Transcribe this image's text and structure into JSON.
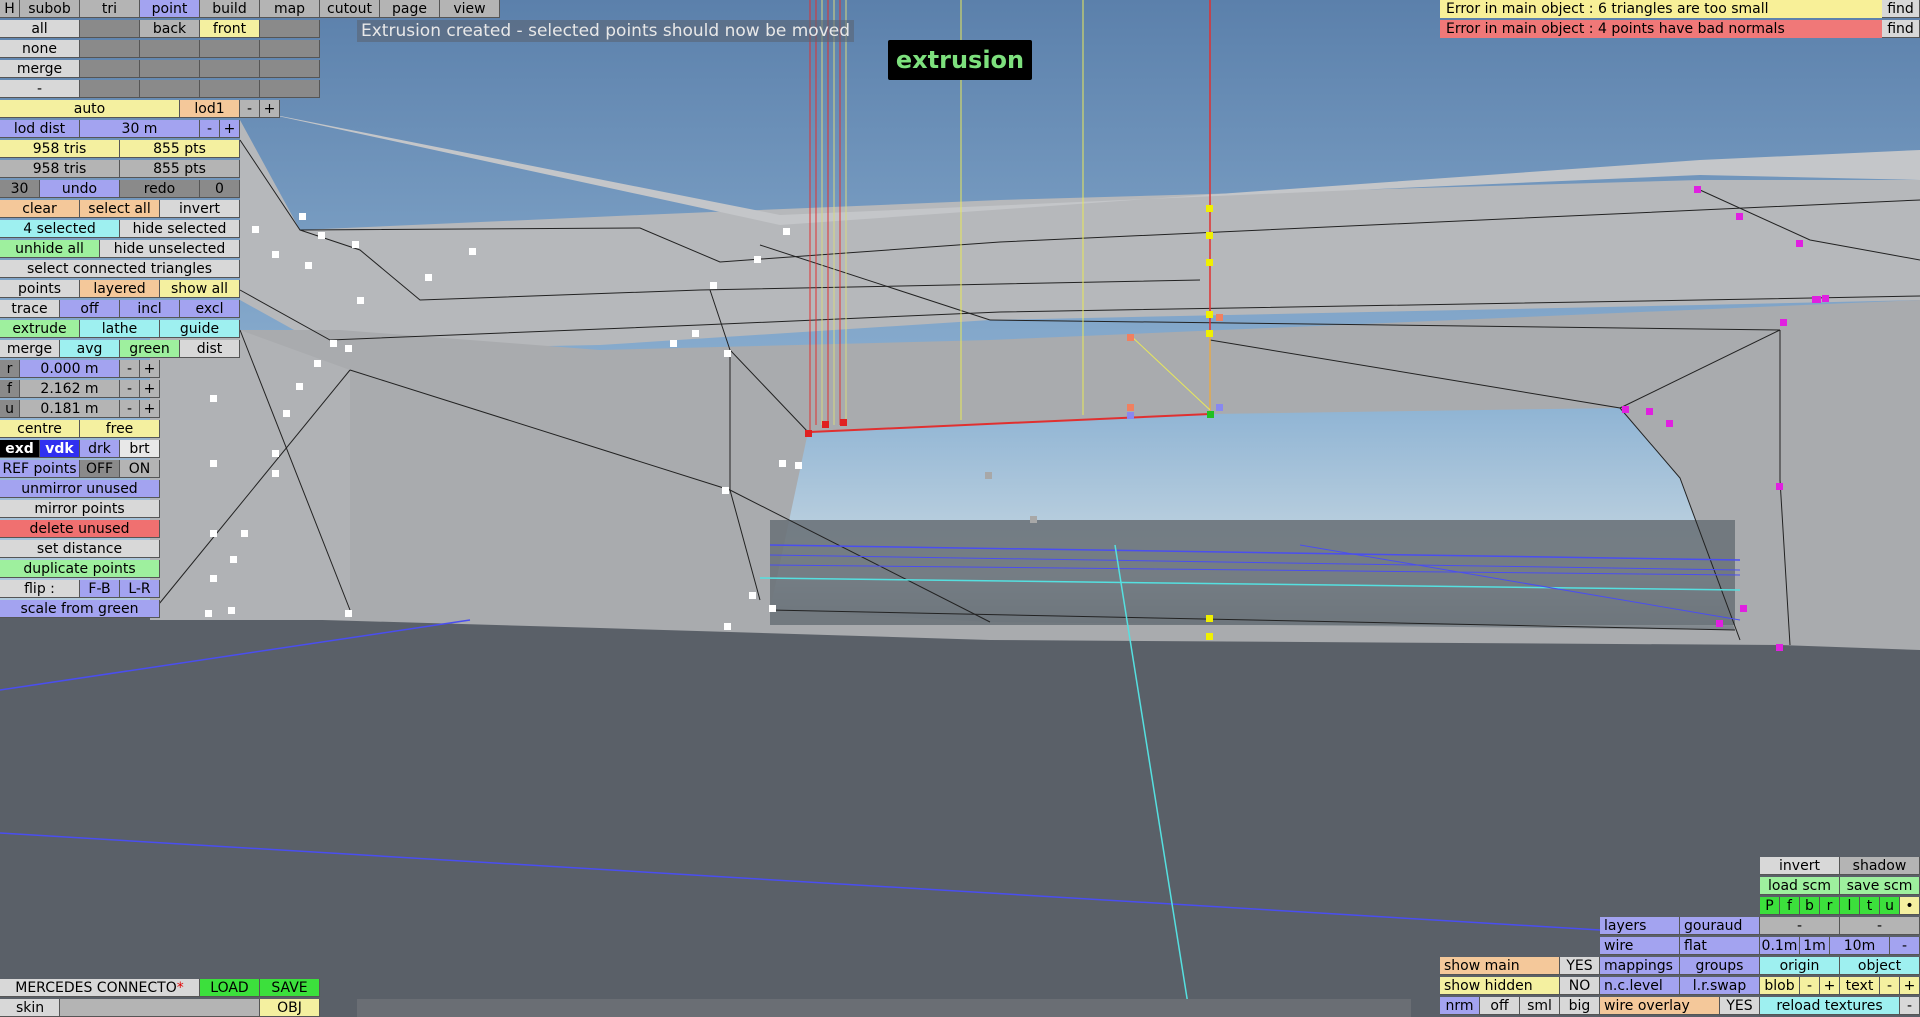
{
  "app": {
    "status_message": "Extrusion created - selected points should now be moved",
    "mode_banner": "extrusion",
    "errors": [
      {
        "text": "Error in main object : 6 triangles are too small",
        "action": "find",
        "color": "#f8f098"
      },
      {
        "text": "Error in main object : 4 points have bad normals",
        "action": "find",
        "color": "#f07878"
      }
    ]
  },
  "top_tabs": [
    "H",
    "subob",
    "tri",
    "point",
    "build",
    "map",
    "cutout",
    "page",
    "view"
  ],
  "top_rows": {
    "row1": [
      "all",
      "",
      "back",
      "front",
      ""
    ],
    "row2": [
      "none",
      "",
      "",
      "",
      ""
    ],
    "row3": [
      "merge",
      "",
      "",
      "",
      ""
    ],
    "row4": [
      "-",
      "",
      "",
      "",
      ""
    ]
  },
  "left_panel": {
    "auto": "auto",
    "lod1": "lod1",
    "minus": "-",
    "plus": "+",
    "lod_dist_label": "lod dist",
    "lod_dist_value": "30 m",
    "tris1": "958 tris",
    "pts1": "855 pts",
    "tris2": "958 tris",
    "pts2": "855 pts",
    "undo_count": "30",
    "undo": "undo",
    "redo": "redo",
    "redo_count": "0",
    "clear": "clear",
    "select_all": "select all",
    "invert": "invert",
    "selected": "4 selected",
    "hide_selected": "hide selected",
    "unhide_all": "unhide all",
    "hide_unselected": "hide unselected",
    "select_connected": "select connected triangles",
    "points": "points",
    "layered": "layered",
    "show_all": "show all",
    "trace": "trace",
    "off": "off",
    "incl": "incl",
    "excl": "excl",
    "extrude": "extrude",
    "lathe": "lathe",
    "guide": "guide",
    "merge": "merge",
    "avg": "avg",
    "green": "green",
    "dist": "dist",
    "r_label": "r",
    "r_value": "0.000 m",
    "f_label": "f",
    "f_value": "2.162 m",
    "u_label": "u",
    "u_value": "0.181 m",
    "centre": "centre",
    "free": "free",
    "exd": "exd",
    "vdk": "vdk",
    "drk": "drk",
    "brt": "brt",
    "ref_points": "REF points",
    "ref_off": "OFF",
    "ref_on": "ON",
    "unmirror_unused": "unmirror unused",
    "mirror_points": "mirror points",
    "delete_unused": "delete unused",
    "set_distance": "set distance",
    "duplicate_points": "duplicate points",
    "flip": "flip :",
    "flip_fb": "F-B",
    "flip_lr": "L-R",
    "scale_from_green": "scale from green"
  },
  "bottom_left": {
    "object_name": "MERCEDES CONNECTO",
    "modified_mark": "*",
    "load": "LOAD",
    "save": "SAVE",
    "skin": "skin",
    "obj": "OBJ"
  },
  "bottom_right": {
    "invert": "invert",
    "shadow": "shadow",
    "load_scm": "load scm",
    "save_scm": "save scm",
    "layers_row": [
      "P",
      "f",
      "b",
      "r",
      "l",
      "t",
      "u",
      "•"
    ],
    "dash1": "-",
    "dash2": "-",
    "layers": "layers",
    "gouraud": "gouraud",
    "wire": "wire",
    "flat": "flat",
    "scale_01": "0.1m",
    "scale_1": "1m",
    "scale_10": "10m",
    "scale_minus": "-",
    "mappings": "mappings",
    "groups": "groups",
    "origin": "origin",
    "object": "object",
    "nc_level": "n.c.level",
    "lr_swap": "l.r.swap",
    "blob": "blob",
    "blob_minus": "-",
    "blob_plus": "+",
    "text": "text",
    "text_minus": "-",
    "text_plus": "+",
    "nrm": "nrm",
    "off": "off",
    "sml": "sml",
    "big": "big",
    "wire_overlay": "wire overlay",
    "wire_overlay_value": "YES",
    "reload_textures": "reload textures",
    "reload_minus": "-",
    "show_main": "show main",
    "show_main_value": "YES",
    "show_hidden": "show hidden",
    "show_hidden_value": "NO"
  }
}
